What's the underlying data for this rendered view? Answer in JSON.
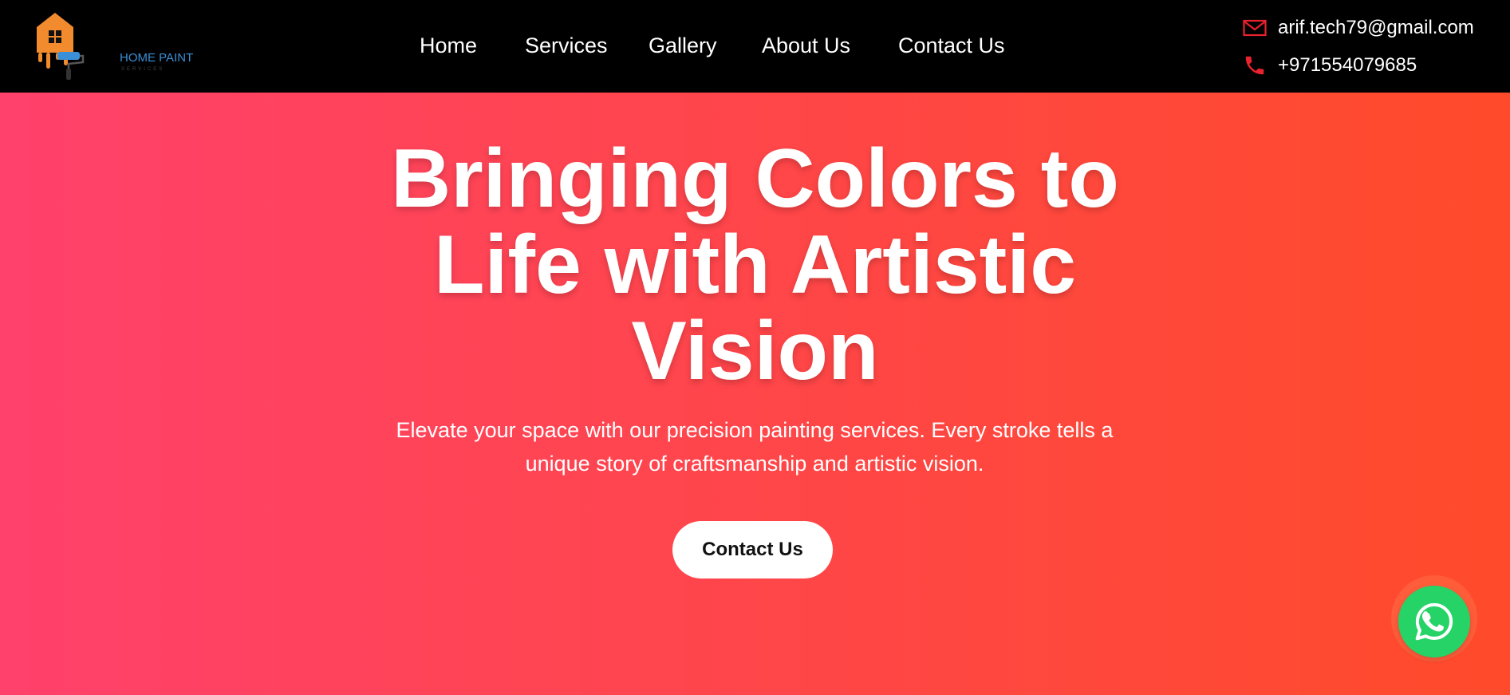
{
  "brand": {
    "name": "HOME PAINT",
    "tagline": "SERVICES",
    "logo_icon": "house-paint-roller-logo",
    "logo_colors": {
      "house": "#f28a2e",
      "roller": "#3a8fd6"
    }
  },
  "nav": {
    "items": [
      {
        "label": "Home"
      },
      {
        "label": "Services"
      },
      {
        "label": "Gallery"
      },
      {
        "label": "About Us"
      },
      {
        "label": "Contact Us"
      }
    ]
  },
  "contact": {
    "email": {
      "icon": "envelope-icon",
      "value": "arif.tech79@gmail.com"
    },
    "phone": {
      "icon": "phone-icon",
      "value": "+971554079685"
    },
    "icon_color": "#e8222e"
  },
  "hero": {
    "title_lines": [
      "Bringing Colors to",
      "Life with Artistic",
      "Vision"
    ],
    "subtitle_line1": "Elevate your space with our precision painting services. Every stroke tells a",
    "subtitle_line2": "unique story of craftsmanship and artistic vision.",
    "cta_label": "Contact Us",
    "gradient_start": "#ff416c",
    "gradient_end": "#ff4b2b"
  },
  "floating": {
    "whatsapp_icon": "whatsapp-icon",
    "color": "#25d366"
  }
}
